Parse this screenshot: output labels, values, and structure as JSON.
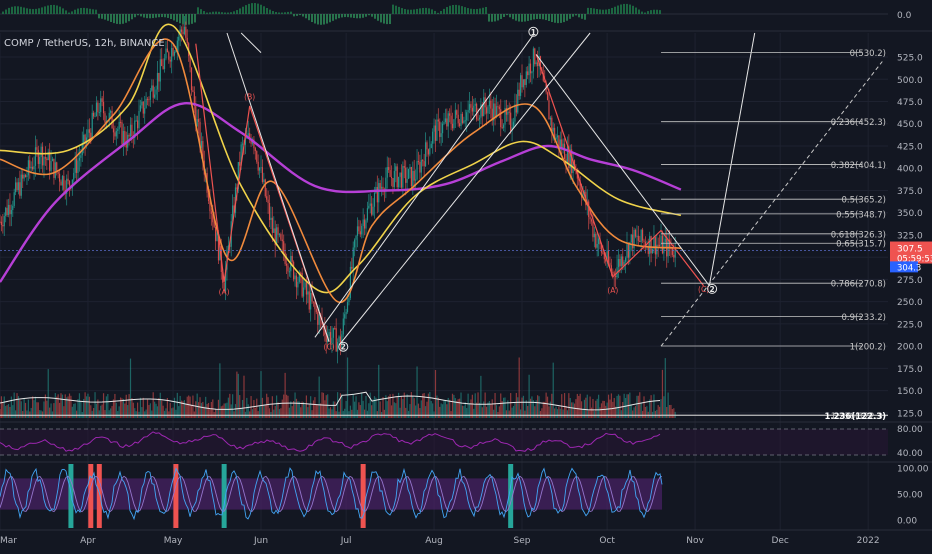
{
  "symbol_label": "COMP / TetherUS, 12h, BINANCE",
  "colors": {
    "background": "#131722",
    "grid": "#1e2230",
    "axis_text": "#b2b5be",
    "price_line": "#8a9a9a",
    "ma_purple": "#b63fd6",
    "ma_yellow": "#f0d34a",
    "ma_orange": "#f08a3c",
    "ma_red": "#e0453a",
    "up": "#26a69a",
    "down": "#ef5350",
    "wave_red": "#ef5350",
    "white": "#e6e6e6",
    "fib": "#c8c8c8",
    "current_price_bg": "#ef5350",
    "blue_tag_bg": "#2962ff",
    "stoch_band": "#4a2266",
    "rsi_line": "#9c27b0",
    "stoch_k": "#42a5f5",
    "stoch_d": "#9575cd"
  },
  "chart_data": {
    "type": "candlestick",
    "price_scale": {
      "ticks": [
        "525.0",
        "500.0",
        "475.0",
        "450.0",
        "425.0",
        "400.0",
        "375.0",
        "350.0",
        "325.0",
        "300.0",
        "275.0",
        "250.0",
        "225.0",
        "200.0",
        "175.0",
        "150.0",
        "125.0"
      ],
      "range": [
        117,
        552
      ]
    },
    "x_axis": {
      "labels": [
        "Mar",
        "Apr",
        "May",
        "Jun",
        "Jul",
        "Aug",
        "Sep",
        "Oct",
        "Nov",
        "Dec",
        "2022"
      ],
      "label_dates": [
        "2021-03-01",
        "2021-04-01",
        "2021-05-01",
        "2021-06-01",
        "2021-07-01",
        "2021-08-01",
        "2021-09-01",
        "2021-10-01",
        "2021-11-01",
        "2021-12-01",
        "2022-01-01"
      ],
      "range": [
        "2021-03-01",
        "2022-01-08"
      ]
    },
    "price_path": [
      [
        "2021-03-01",
        340
      ],
      [
        "2021-03-15",
        420
      ],
      [
        "2021-03-25",
        380
      ],
      [
        "2021-04-05",
        470
      ],
      [
        "2021-04-15",
        430
      ],
      [
        "2021-04-28",
        520
      ],
      [
        "2021-05-05",
        560
      ],
      [
        "2021-05-08",
        480
      ],
      [
        "2021-05-11",
        420
      ],
      [
        "2021-05-19",
        272
      ],
      [
        "2021-05-25",
        420
      ],
      [
        "2021-05-29",
        439
      ],
      [
        "2021-06-05",
        330
      ],
      [
        "2021-06-15",
        270
      ],
      [
        "2021-06-24",
        215
      ],
      [
        "2021-06-29",
        203
      ],
      [
        "2021-07-05",
        330
      ],
      [
        "2021-07-15",
        390
      ],
      [
        "2021-07-25",
        390
      ],
      [
        "2021-08-01",
        440
      ],
      [
        "2021-08-10",
        460
      ],
      [
        "2021-08-20",
        470
      ],
      [
        "2021-08-28",
        450
      ],
      [
        "2021-09-01",
        500
      ],
      [
        "2021-09-06",
        528
      ],
      [
        "2021-09-12",
        440
      ],
      [
        "2021-09-20",
        400
      ],
      [
        "2021-09-27",
        320
      ],
      [
        "2021-10-03",
        282
      ],
      [
        "2021-10-10",
        320
      ],
      [
        "2021-10-18",
        315
      ],
      [
        "2021-10-25",
        307.5
      ]
    ],
    "current_price": "307.5",
    "countdown": "05:59:53",
    "blue_tag": "304.3",
    "oscillator_top_tag": "0.0",
    "moving_averages": [
      {
        "color_key": "ma_purple",
        "points": [
          [
            "2021-03-01",
            272
          ],
          [
            "2021-03-20",
            360
          ],
          [
            "2021-04-15",
            430
          ],
          [
            "2021-05-05",
            473
          ],
          [
            "2021-05-25",
            440
          ],
          [
            "2021-06-20",
            380
          ],
          [
            "2021-07-15",
            375
          ],
          [
            "2021-08-05",
            382
          ],
          [
            "2021-08-25",
            408
          ],
          [
            "2021-09-10",
            425
          ],
          [
            "2021-09-25",
            410
          ],
          [
            "2021-10-10",
            398
          ],
          [
            "2021-10-27",
            376
          ]
        ]
      },
      {
        "color_key": "ma_yellow",
        "points": [
          [
            "2021-03-01",
            420
          ],
          [
            "2021-03-25",
            420
          ],
          [
            "2021-04-15",
            470
          ],
          [
            "2021-05-01",
            560
          ],
          [
            "2021-05-25",
            380
          ],
          [
            "2021-06-20",
            265
          ],
          [
            "2021-07-05",
            290
          ],
          [
            "2021-07-25",
            368
          ],
          [
            "2021-08-15",
            405
          ],
          [
            "2021-09-01",
            430
          ],
          [
            "2021-09-15",
            410
          ],
          [
            "2021-10-05",
            365
          ],
          [
            "2021-10-27",
            347
          ]
        ]
      },
      {
        "color_key": "ma_orange",
        "points": [
          [
            "2021-03-01",
            410
          ],
          [
            "2021-03-20",
            395
          ],
          [
            "2021-04-10",
            460
          ],
          [
            "2021-05-01",
            540
          ],
          [
            "2021-05-20",
            300
          ],
          [
            "2021-06-05",
            385
          ],
          [
            "2021-06-28",
            250
          ],
          [
            "2021-07-10",
            335
          ],
          [
            "2021-07-25",
            380
          ],
          [
            "2021-08-15",
            440
          ],
          [
            "2021-09-05",
            470
          ],
          [
            "2021-09-20",
            380
          ],
          [
            "2021-10-05",
            320
          ],
          [
            "2021-10-27",
            310
          ]
        ]
      }
    ],
    "fib_levels": [
      {
        "ratio": "0",
        "price": "530.2",
        "label": "0(530.2)"
      },
      {
        "ratio": "0.236",
        "price": "452.3",
        "label": "0.236(452.3)"
      },
      {
        "ratio": "0.382",
        "price": "404.1",
        "label": "0.382(404.1)"
      },
      {
        "ratio": "0.5",
        "price": "365.2",
        "label": "0.5(365.2)"
      },
      {
        "ratio": "0.55",
        "price": "348.7",
        "label": "0.55(348.7)"
      },
      {
        "ratio": "0.618",
        "price": "326.3",
        "label": "0.618(326.3)"
      },
      {
        "ratio": "0.65",
        "price": "315.7",
        "label": "0.65(315.7)"
      },
      {
        "ratio": "0.786",
        "price": "270.8",
        "label": "0.786(270.8)"
      },
      {
        "ratio": "0.9",
        "price": "233.2",
        "label": "0.9(233.2)"
      },
      {
        "ratio": "1",
        "price": "200.2",
        "label": "1(200.2)"
      },
      {
        "ratio": "1.236",
        "price": "122.3",
        "label": "1.236(122.3)"
      }
    ],
    "fib_start_date": "2021-10-20",
    "wave_labels": [
      {
        "text": "(A)",
        "color_key": "wave_red",
        "date": "2021-05-19",
        "price": 258
      },
      {
        "text": "(B)",
        "color_key": "wave_red",
        "date": "2021-05-28",
        "price": 477
      },
      {
        "text": "(C)",
        "color_key": "wave_red",
        "date": "2021-06-25",
        "price": 196
      },
      {
        "text": "2",
        "color_key": "white",
        "circled": true,
        "date": "2021-06-30",
        "price": 196
      },
      {
        "text": "1",
        "color_key": "white",
        "circled": true,
        "date": "2021-09-05",
        "price": 550
      },
      {
        "text": "(A)",
        "color_key": "wave_red",
        "date": "2021-10-03",
        "price": 260
      },
      {
        "text": "(C)",
        "color_key": "wave_red",
        "date": "2021-11-04",
        "price": 261
      },
      {
        "text": "2",
        "color_key": "white",
        "circled": true,
        "date": "2021-11-07",
        "price": 261
      }
    ],
    "drawings": {
      "red_abc_path": [
        [
          "2021-05-09",
          540
        ],
        [
          "2021-05-19",
          272
        ],
        [
          "2021-05-28",
          470
        ],
        [
          "2021-06-25",
          205
        ]
      ],
      "red_recent_path": [
        [
          "2021-09-06",
          528
        ],
        [
          "2021-10-03",
          278
        ],
        [
          "2021-10-20",
          330
        ],
        [
          "2021-11-04",
          268
        ]
      ],
      "white_channel_1": [
        [
          "2021-06-20",
          210
        ],
        [
          "2021-09-05",
          550
        ]
      ],
      "white_channel_2": [
        [
          "2021-06-29",
          203
        ],
        [
          "2021-09-25",
          552
        ]
      ],
      "white_diagonal": [
        [
          "2021-09-06",
          528
        ],
        [
          "2021-11-06",
          268
        ]
      ],
      "white_projection": [
        [
          "2021-11-06",
          268
        ],
        [
          "2021-11-22",
          552
        ]
      ],
      "white_top_left": [
        [
          "2021-05-20",
          552
        ],
        [
          "2021-06-25",
          205
        ]
      ],
      "white_top_left_2": [
        [
          "2021-05-25",
          552
        ],
        [
          "2021-06-01",
          530
        ]
      ],
      "dashed_projection": [
        [
          "2021-10-20",
          200
        ],
        [
          "2022-01-06",
          520
        ]
      ]
    },
    "volume": {
      "level_price": "122.3"
    },
    "rsi": {
      "ticks": [
        "80.00",
        "40.00"
      ]
    },
    "stochastic": {
      "ticks": [
        "100.00",
        "50.00",
        "0.00"
      ],
      "highlight_bars": [
        {
          "date": "2021-03-26",
          "color_key": "up"
        },
        {
          "date": "2021-04-02",
          "color_key": "down"
        },
        {
          "date": "2021-04-05",
          "color_key": "down"
        },
        {
          "date": "2021-05-02",
          "color_key": "down"
        },
        {
          "date": "2021-05-19",
          "color_key": "up"
        },
        {
          "date": "2021-07-07",
          "color_key": "down"
        },
        {
          "date": "2021-08-28",
          "color_key": "up"
        }
      ]
    }
  }
}
